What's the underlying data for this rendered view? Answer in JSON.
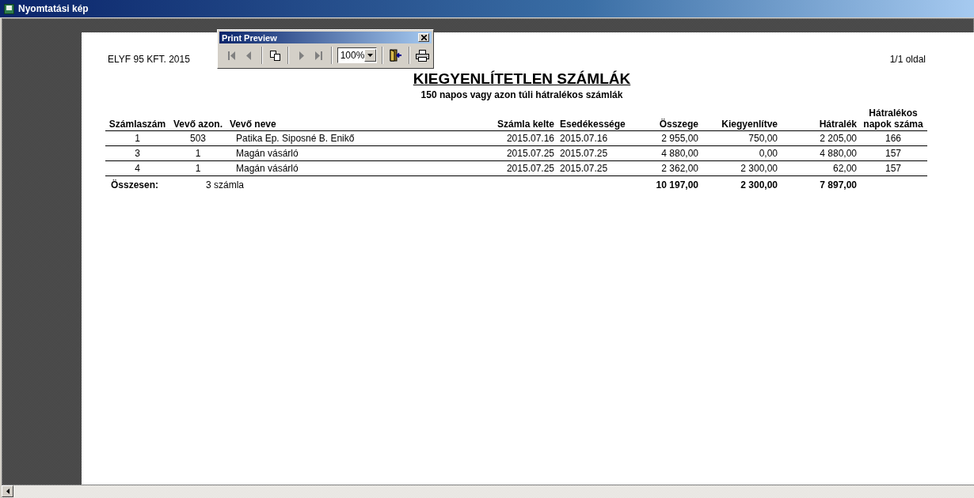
{
  "window": {
    "title": "Nyomtatási kép"
  },
  "toolbar": {
    "title": "Print Preview",
    "groups": [
      [
        {
          "kind": "first",
          "disabled": true
        },
        {
          "kind": "previous",
          "disabled": true
        }
      ],
      [
        {
          "kind": "pages",
          "disabled": false
        }
      ],
      [
        {
          "kind": "next",
          "disabled": true
        },
        {
          "kind": "last",
          "disabled": true
        }
      ],
      [
        {
          "kind": "zoom",
          "value": "100%"
        }
      ],
      [
        {
          "kind": "close",
          "disabled": false
        }
      ],
      [
        {
          "kind": "print",
          "disabled": false
        }
      ]
    ]
  },
  "report": {
    "header_left": "ELYF 95 KFT. 2015",
    "header_right": "1/1 oldal",
    "title": "KIEGYENLÍTETLEN SZÁMLÁK",
    "subtitle": "150 napos vagy azon túli hátralékos számlák",
    "columns": [
      "Számlaszám",
      "Vevő azon.",
      "Vevő neve",
      "Számla kelte",
      "Esedékessége",
      "Összege",
      "Kiegyenlítve",
      "Hátralék",
      "Hátralékos napok száma"
    ],
    "rows": [
      [
        "1",
        "503",
        "Patika Ep. Siposné B. Enikő",
        "2015.07.16",
        "2015.07.16",
        "2 955,00",
        "750,00",
        "2 205,00",
        "166"
      ],
      [
        "3",
        "1",
        "Magán vásárló",
        "2015.07.25",
        "2015.07.25",
        "4 880,00",
        "0,00",
        "4 880,00",
        "157"
      ],
      [
        "4",
        "1",
        "Magán vásárló",
        "2015.07.25",
        "2015.07.25",
        "2 362,00",
        "2 300,00",
        "62,00",
        "157"
      ]
    ],
    "total": {
      "label": "Összesen:",
      "count": "3 számla",
      "sums": [
        "10 197,00",
        "2 300,00",
        "7 897,00"
      ]
    }
  }
}
